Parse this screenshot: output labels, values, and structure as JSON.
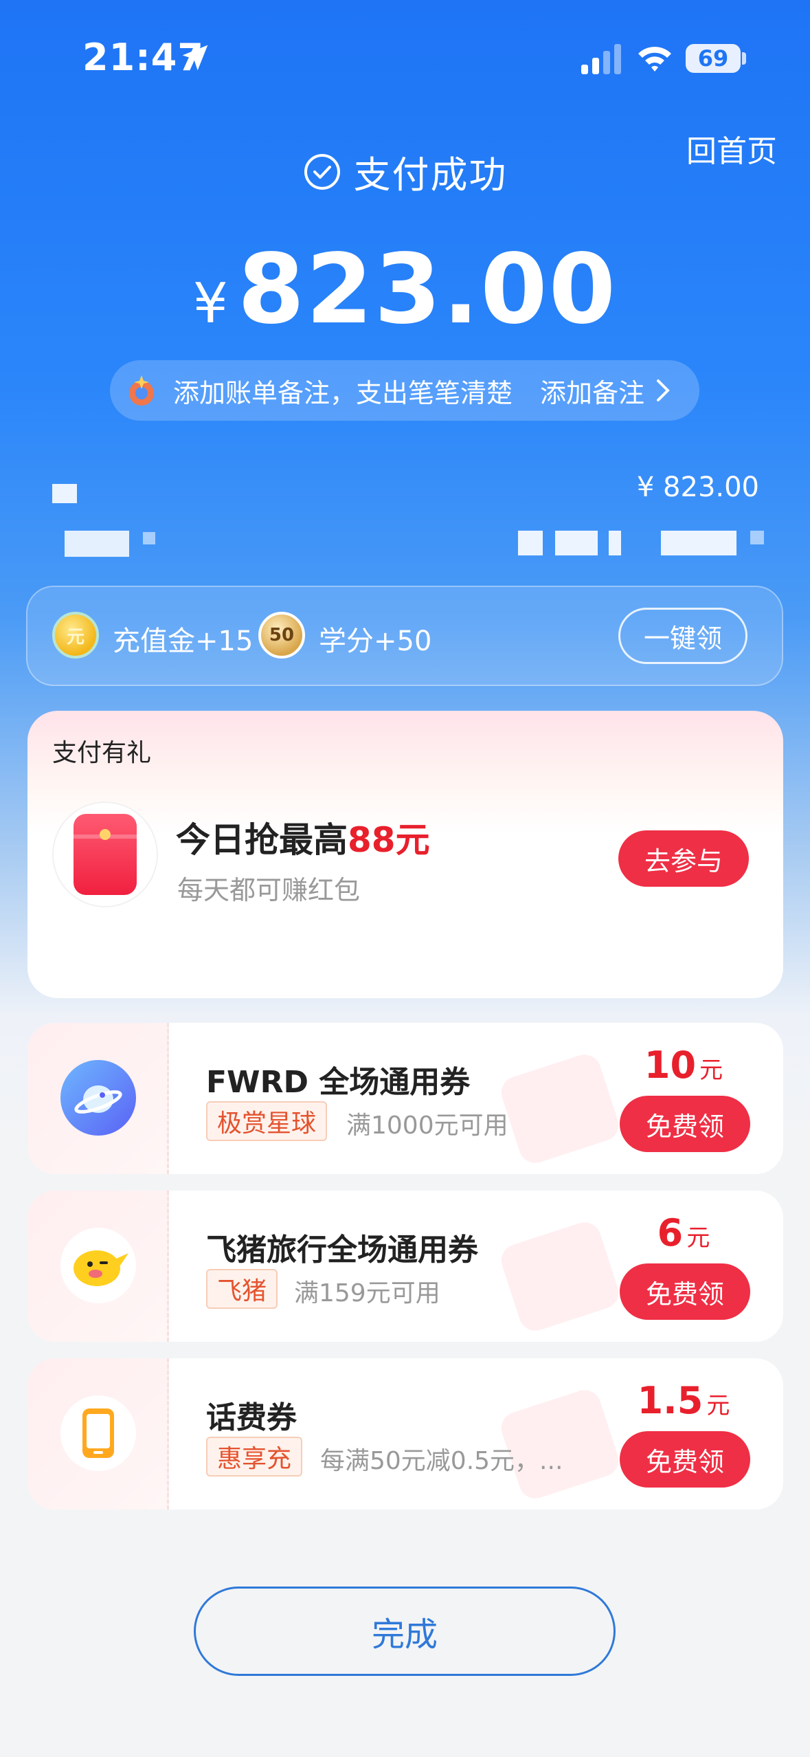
{
  "status_bar": {
    "time": "21:47",
    "battery": "69"
  },
  "header": {
    "home_link": "回首页",
    "status_text": "支付成功"
  },
  "payment": {
    "currency": "¥",
    "amount": "823.00"
  },
  "note_banner": {
    "text": "添加账单备注，支出笔笔清楚",
    "action": "添加备注"
  },
  "merchant": {
    "amount": "¥ 823.00"
  },
  "rewards": {
    "items": [
      {
        "coin_text": "元",
        "label": "充值金+15"
      },
      {
        "coin_text": "50",
        "label": "学分+50"
      }
    ],
    "claim_all": "一键领"
  },
  "gift": {
    "section_title": "支付有礼",
    "headline_prefix": "今日抢最高",
    "headline_highlight": "88元",
    "subtitle": "每天都可赚红包",
    "button": "去参与"
  },
  "coupons": [
    {
      "title": "FWRD 全场通用券",
      "tag": "极赏星球",
      "condition": "满1000元可用",
      "value": "10",
      "unit": "元",
      "button": "免费领",
      "logo": "planet-icon"
    },
    {
      "title": "飞猪旅行全场通用券",
      "tag": "飞猪",
      "condition": "满159元可用",
      "value": "6",
      "unit": "元",
      "button": "免费领",
      "logo": "fliggy-icon"
    },
    {
      "title": "话费券",
      "tag": "惠享充",
      "condition": "每满50元减0.5元，...",
      "value": "1.5",
      "unit": "元",
      "button": "免费领",
      "logo": "phone-icon"
    }
  ],
  "footer": {
    "done": "完成"
  },
  "colors": {
    "primary_blue": "#1e74f5",
    "accent_red": "#ef2f45",
    "tag_orange": "#e4532f"
  }
}
